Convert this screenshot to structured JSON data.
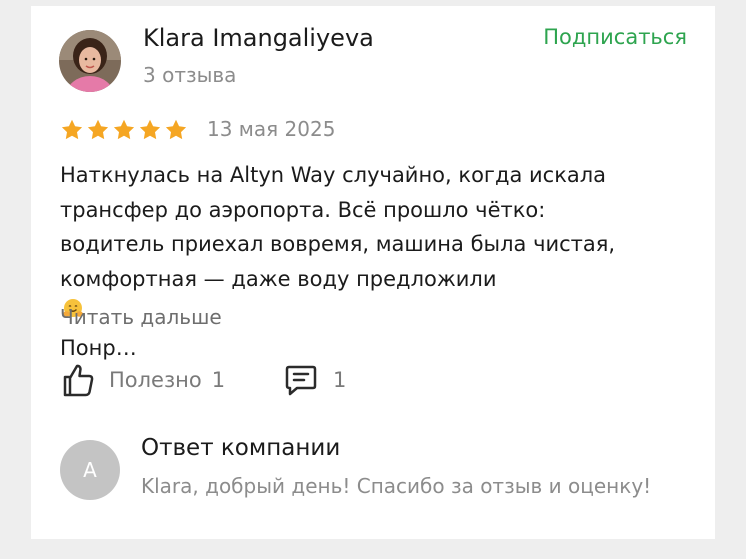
{
  "author": {
    "name": "Klara Imangaliyeva",
    "review_count": "3 отзыва",
    "avatar_icon": "user-photo"
  },
  "subscribe_label": "Подписаться",
  "rating": {
    "value": 5,
    "max": 5,
    "star_color": "#f5a623"
  },
  "date": "13 мая 2025",
  "review": {
    "lines": [
      "Наткнулась на Altyn Way случайно, когда искала",
      "трансфер до аэропорта. Всё прошло чётко:",
      "водитель приехал вовремя, машина была чистая,",
      "комфортная — даже воду предложили",
      "Понр…"
    ],
    "emoji": "hugging-face"
  },
  "read_more_label": "Читать дальше",
  "actions": {
    "useful_label": "Полезно",
    "useful_count": "1",
    "comments_count": "1"
  },
  "company_reply": {
    "avatar_letter": "A",
    "title": "Ответ компании",
    "text": "Klara, добрый день! Спасибо за отзыв и оценку!"
  },
  "colors": {
    "accent_green": "#2ea44f",
    "star": "#f5a623",
    "muted_text": "#8c8c8c"
  }
}
